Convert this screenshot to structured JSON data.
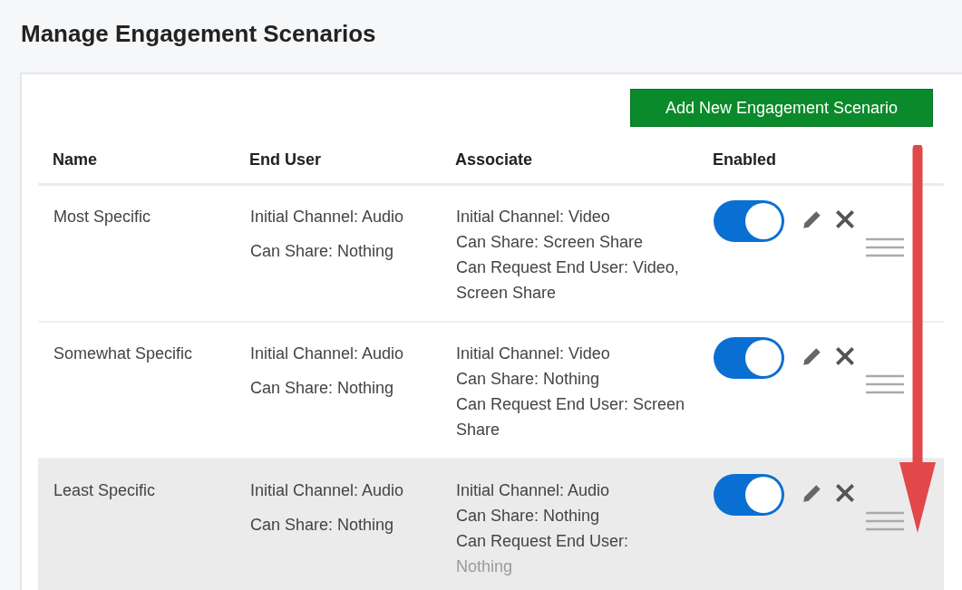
{
  "title": "Manage Engagement Scenarios",
  "add_button": "Add New Engagement Scenario",
  "columns": [
    "Name",
    "End User",
    "Associate",
    "Enabled"
  ],
  "rows": [
    {
      "name": "Most Specific",
      "end_user": [
        "Initial Channel: Audio",
        "Can Share: Nothing"
      ],
      "associate": [
        "Initial Channel: Video",
        "Can Share: Screen Share",
        "Can Request End User: Video, Screen Share"
      ],
      "enabled": true,
      "highlighted": false
    },
    {
      "name": "Somewhat Specific",
      "end_user": [
        "Initial Channel: Audio",
        "Can Share: Nothing"
      ],
      "associate": [
        "Initial Channel: Video",
        "Can Share: Nothing",
        "Can Request End User: Screen Share"
      ],
      "enabled": true,
      "highlighted": false
    },
    {
      "name": "Least Specific",
      "end_user": [
        "Initial Channel: Audio",
        "Can Share: Nothing"
      ],
      "associate": [
        "Initial Channel: Audio",
        "Can Share: Nothing",
        "Can Request End User:",
        "Nothing"
      ],
      "enabled": true,
      "highlighted": true
    }
  ]
}
